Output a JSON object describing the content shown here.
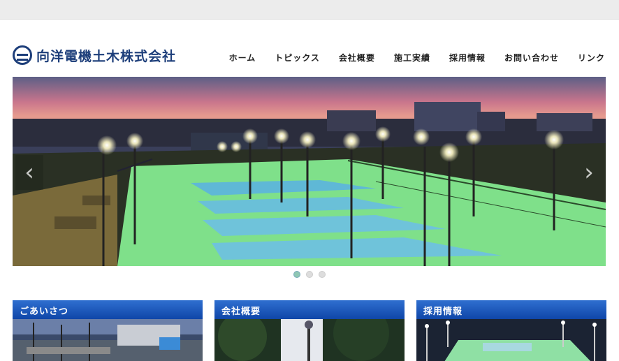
{
  "header": {
    "logo_text": "向洋電機土木株式会社",
    "nav": [
      "ホーム",
      "トピックス",
      "会社概要",
      "施工実績",
      "採用情報",
      "お問い合わせ",
      "リンク"
    ]
  },
  "slider": {
    "prev_glyph": "‹",
    "next_glyph": "›",
    "slide_count": 3,
    "active_slide": 1
  },
  "cards": [
    {
      "title": "ごあいさつ"
    },
    {
      "title": "会社概要"
    },
    {
      "title": "採用情報"
    }
  ],
  "colors": {
    "brand": "#1d3e7a",
    "card_header": "#1550b8",
    "court": "#7fe08a",
    "active_dot": "#8fc7b3"
  }
}
